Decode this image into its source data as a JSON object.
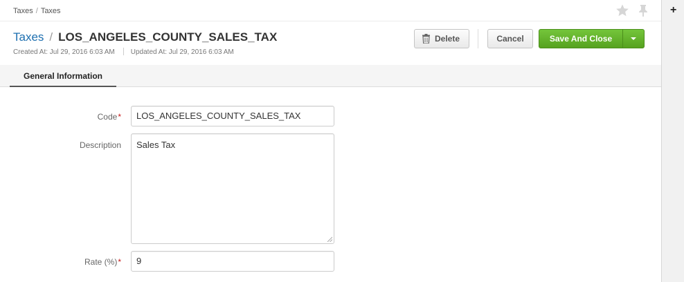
{
  "breadcrumb": {
    "items": [
      "Taxes",
      "Taxes"
    ],
    "separator": "/"
  },
  "header": {
    "entity_link": "Taxes",
    "separator": "/",
    "record_name": "LOS_ANGELES_COUNTY_SALES_TAX",
    "created_at": "Created At: Jul 29, 2016 6:03 AM",
    "updated_at": "Updated At: Jul 29, 2016 6:03 AM"
  },
  "actions": {
    "delete_label": "Delete",
    "cancel_label": "Cancel",
    "save_label": "Save And Close"
  },
  "tabs": [
    {
      "label": "General Information",
      "active": true
    }
  ],
  "form": {
    "code": {
      "label": "Code",
      "required": "*",
      "value": "LOS_ANGELES_COUNTY_SALES_TAX"
    },
    "description": {
      "label": "Description",
      "value": "Sales Tax"
    },
    "rate": {
      "label": "Rate (%)",
      "required": "*",
      "value": "9"
    }
  },
  "sidepanel": {
    "add_label": "+"
  },
  "icons": [
    "star-icon",
    "pin-icon",
    "trash-icon",
    "caret-down-icon",
    "plus-icon"
  ],
  "colors": {
    "link": "#1d6fb0",
    "save_button": "#5fae27",
    "required": "#c81818"
  }
}
